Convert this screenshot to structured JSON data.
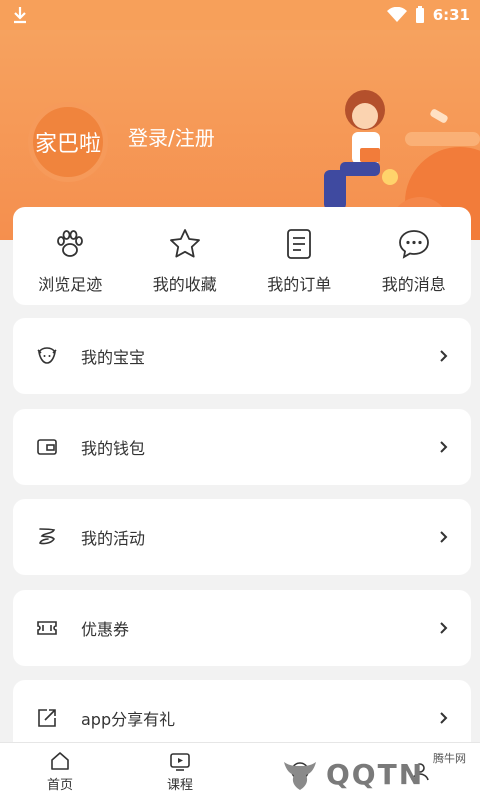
{
  "status_bar": {
    "time": "6:31",
    "download_icon": "download-icon",
    "wifi_icon": "wifi-icon",
    "battery_icon": "battery-icon"
  },
  "header": {
    "logo_text": "家巴啦",
    "login_label": "登录/注册",
    "colors": {
      "bg": "#f6a25f",
      "accent": "#f0843d"
    }
  },
  "quick_actions": [
    {
      "label": "浏览足迹",
      "icon": "paw-icon"
    },
    {
      "label": "我的收藏",
      "icon": "star-icon"
    },
    {
      "label": "我的订单",
      "icon": "order-list-icon"
    },
    {
      "label": "我的消息",
      "icon": "message-bubble-icon"
    }
  ],
  "menu": [
    {
      "label": "我的宝宝",
      "icon": "baby-face-icon"
    },
    {
      "label": "我的钱包",
      "icon": "wallet-icon"
    },
    {
      "label": "我的活动",
      "icon": "activity-icon"
    },
    {
      "label": "优惠券",
      "icon": "coupon-icon"
    },
    {
      "label": "app分享有礼",
      "icon": "share-icon"
    }
  ],
  "tab_bar": [
    {
      "label": "首页",
      "icon": "home-icon"
    },
    {
      "label": "课程",
      "icon": "tv-icon"
    },
    {
      "label": "",
      "icon": "center-icon"
    },
    {
      "label": "",
      "icon": "profile-icon"
    }
  ],
  "watermark": {
    "text": "QQTN",
    "sub": "腾牛网"
  }
}
